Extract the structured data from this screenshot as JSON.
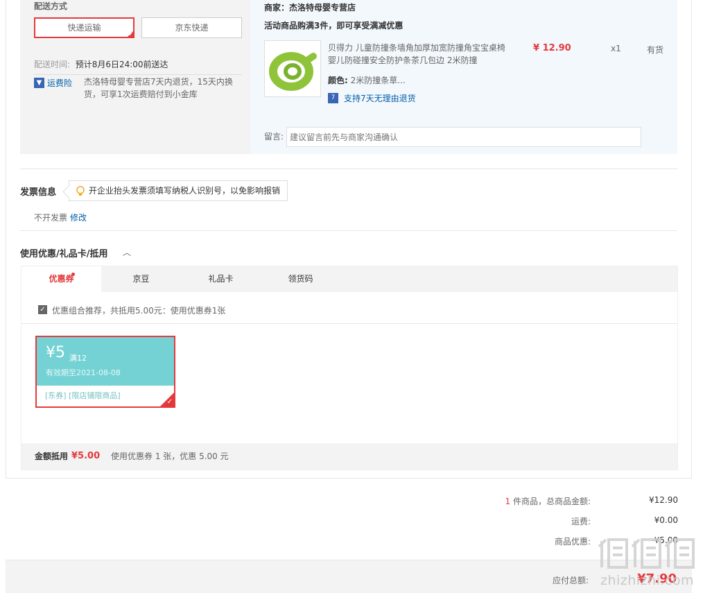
{
  "shipping": {
    "title": "配送方式",
    "options": [
      "快递运输",
      "京东快递"
    ],
    "time_label": "配送时间:",
    "time_value": "预计8月6日24:00前送达",
    "insurance_icon": "shield-icon",
    "insurance_label": "运费险",
    "insurance_text": "杰洛特母婴专营店7天内退货，15天内换货，可享1次运费赔付到小金库"
  },
  "order": {
    "merchant": "商家：杰洛特母婴专营店",
    "promo": "活动商品购满3件，即可享受满减优惠",
    "product": {
      "name": "贝得力 儿童防撞条墙角加厚加宽防撞角宝宝桌椅婴儿防碰撞安全防护条茶几包边 2米防撞",
      "price": "¥ 12.90",
      "qty": "x1",
      "stock": "有货",
      "color_label": "颜色:",
      "color_value": "2米防撞条草...",
      "return_policy": "支持7天无理由退货"
    },
    "note_label": "留言:",
    "note_placeholder": "建议留言前先与商家沟通确认"
  },
  "invoice": {
    "title": "发票信息",
    "tip": "开企业抬头发票须填写纳税人识别号，以免影响报销",
    "status": "不开发票",
    "edit": "修改"
  },
  "coupons": {
    "title": "使用优惠/礼品卡/抵用",
    "toggle_icon": "chevron-up-icon",
    "tabs": [
      "优惠券",
      "京豆",
      "礼品卡",
      "领货码"
    ],
    "combo_text": "优惠组合推荐，共抵用5.00元：使用优惠券1张",
    "coupon": {
      "amount": "¥5",
      "condition": "满12",
      "validity": "有效期至2021-08-08",
      "tags": "[东券]  [限店铺限商品]"
    },
    "footer_label": "金额抵用",
    "footer_amount": "¥5.00",
    "footer_info": "使用优惠券 1 张，优惠 5.00 元"
  },
  "totals": {
    "count": "1",
    "items_label": " 件商品，总商品金额:",
    "items_value": "¥12.90",
    "shipping_label": "运费:",
    "shipping_value": "¥0.00",
    "discount_label": "商品优惠:",
    "discount_value": "-¥5.00",
    "payable_label": "应付总额:",
    "payable_value": "¥7.90"
  },
  "watermark": {
    "logo_text": "值值值",
    "site": "zhizhizhi.com"
  },
  "colors": {
    "accent": "#e4393c",
    "link": "#005ea7",
    "coupon": "#74d2d4"
  }
}
